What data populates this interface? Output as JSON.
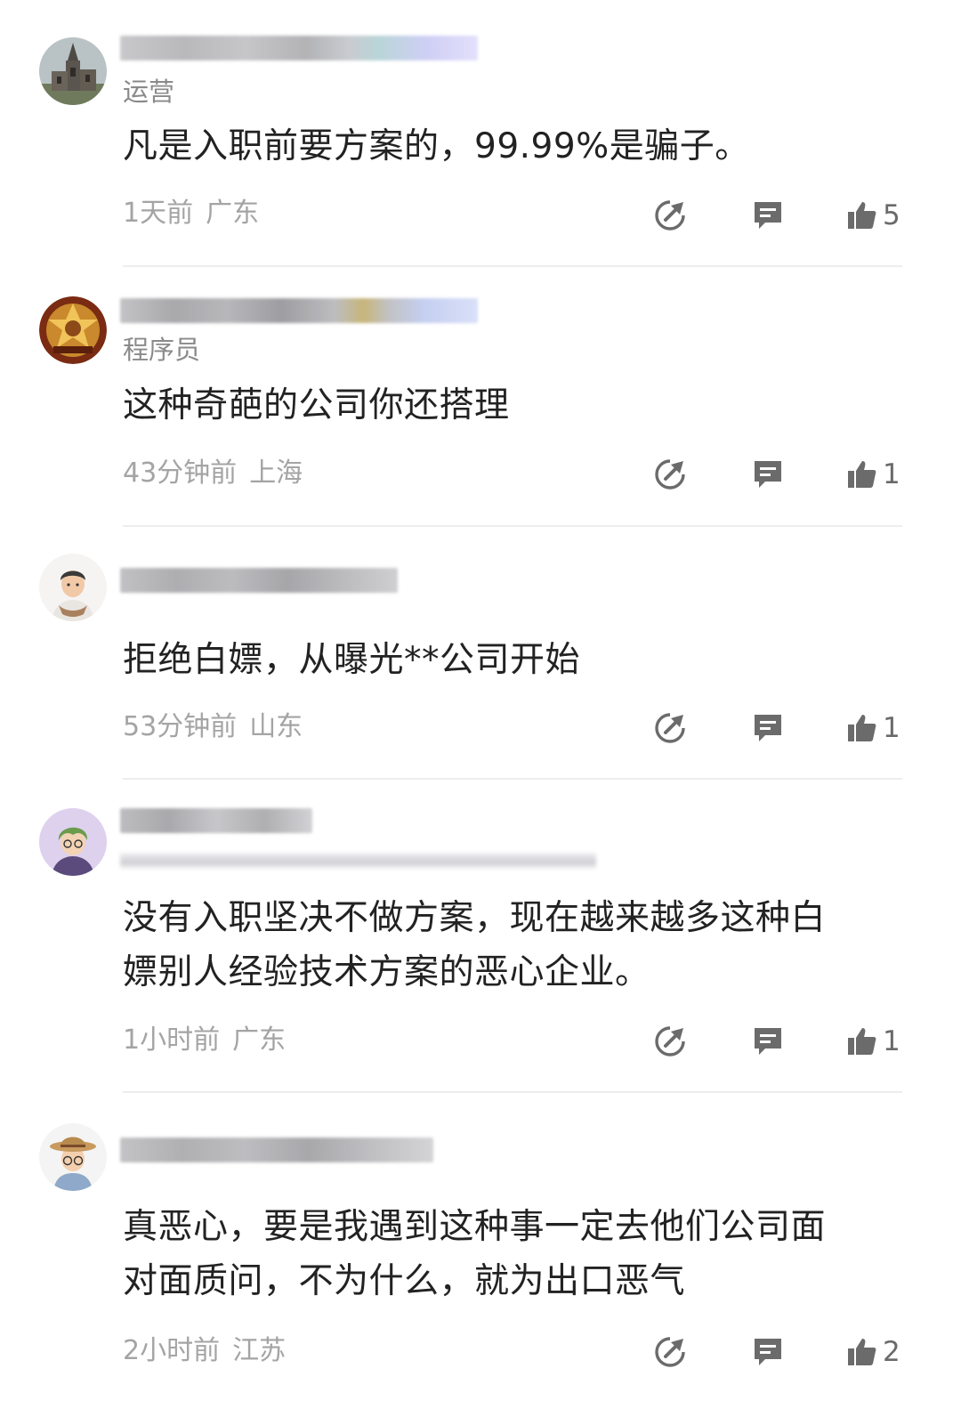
{
  "comments": [
    {
      "role": "运营",
      "content": "凡是入职前要方案的，99.99%是骗子。",
      "time": "1天前",
      "location": "广东",
      "likes": "5",
      "avatar": "church-avatar"
    },
    {
      "role": "程序员",
      "content": "这种奇葩的公司你还搭理",
      "time": "43分钟前",
      "location": "上海",
      "likes": "1",
      "avatar": "gold-crest-avatar"
    },
    {
      "role": "",
      "content": "拒绝白嫖，从曝光**公司开始",
      "time": "53分钟前",
      "location": "山东",
      "likes": "1",
      "avatar": "man-scarf-avatar"
    },
    {
      "role": "",
      "content_lines": [
        "没有入职坚决不做方案，现在越来越多这种白",
        "嫖别人经验技术方案的恶心企业。"
      ],
      "time": "1小时前",
      "location": "广东",
      "likes": "1",
      "avatar": "green-hair-avatar"
    },
    {
      "role": "",
      "content_lines": [
        "真恶心，要是我遇到这种事一定去他们公司面",
        "对面质问，不为什么，就为出口恶气"
      ],
      "time": "2小时前",
      "location": "江苏",
      "likes": "2",
      "avatar": "hat-glasses-avatar"
    }
  ],
  "icons": {
    "share": "share-icon",
    "reply": "reply-icon",
    "like": "thumbs-up-icon"
  },
  "colors": {
    "text": "#222222",
    "secondary": "#a4a4a4",
    "role": "#8a8a8a",
    "icon": "#6b6b6b"
  }
}
